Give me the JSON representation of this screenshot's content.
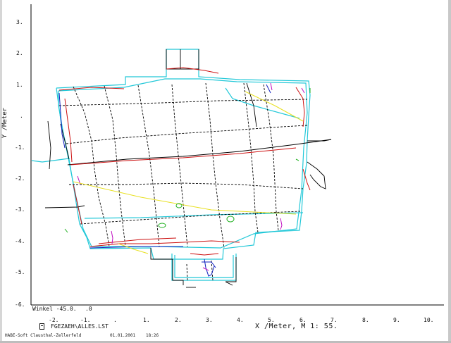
{
  "axes": {
    "y_label": "Y /Meter",
    "y_ticks": [
      "3.",
      "2.",
      "1.",
      ".",
      "-1.",
      "-2.",
      "-3.",
      "-4.",
      "-5.",
      "-6."
    ],
    "x_ticks": [
      "-2.",
      "-1.",
      ".",
      "1.",
      "2.",
      "3.",
      "4.",
      "5.",
      "6.",
      "7.",
      "8.",
      "9.",
      "10."
    ],
    "x_label": "X /Meter, M 1: 55.",
    "extra_tick": ".0"
  },
  "status": {
    "angle": "Winkel -45.0.",
    "file": "FGEZAEH\\ALLES.LST",
    "footer": "HABE-Soft Clausthal-Zellerfeld",
    "date": "01.01.2001",
    "time": "18:26"
  },
  "colors": {
    "outline_cyan": "#22c8d8",
    "survey_black": "#000000",
    "trace_red": "#cc1010",
    "trace_blue": "#1020c0",
    "trace_magenta": "#c010c0",
    "trace_yellow": "#e8e020",
    "trace_green": "#20b020"
  }
}
